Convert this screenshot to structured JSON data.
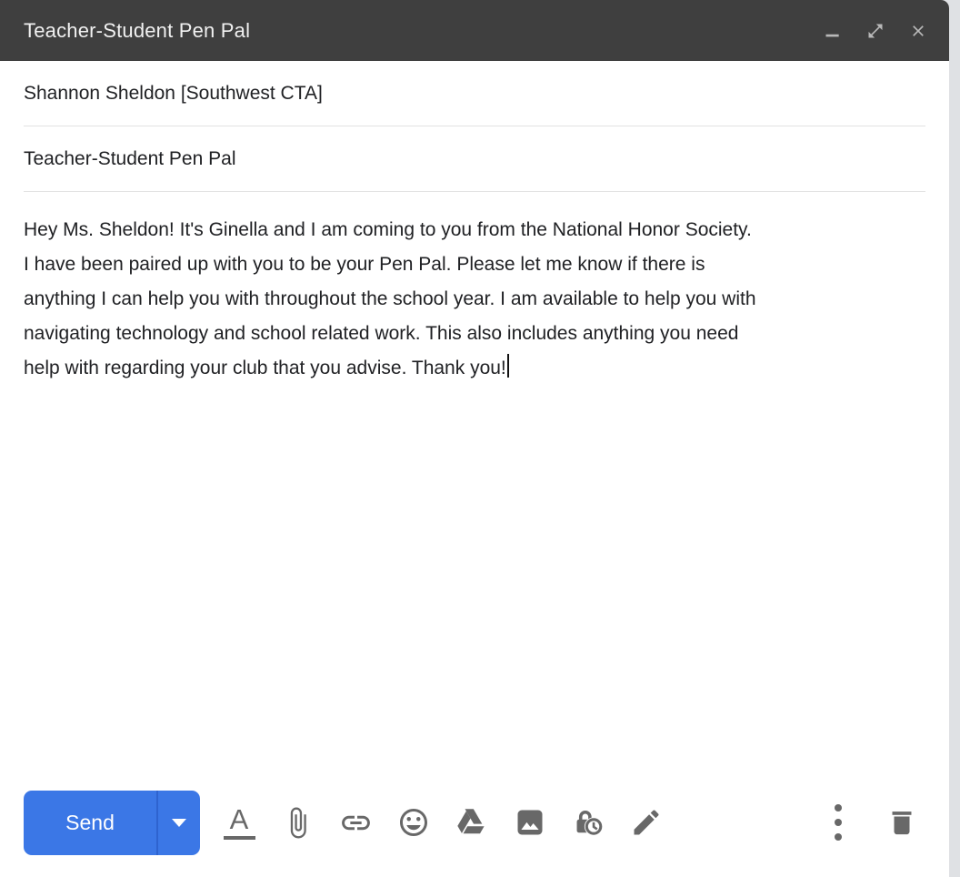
{
  "window": {
    "title": "Teacher-Student Pen Pal",
    "controls": [
      "minimize",
      "pop-out",
      "close"
    ]
  },
  "compose": {
    "recipient": "Shannon Sheldon [Southwest CTA]",
    "subject": "Teacher-Student Pen Pal",
    "body_lines": [
      "Hey Ms. Sheldon! It's Ginella and I am coming to you from the National Honor Society.",
      "I have been paired up with you to be your Pen Pal. Please let me know if there is",
      "anything I can help you with throughout the school year. I am available to help you with",
      "navigating technology and school related work. This also includes anything you need",
      "help with regarding your club that you advise. Thank you!"
    ]
  },
  "toolbar": {
    "send_label": "Send",
    "format_letter": "A",
    "icons": [
      "formatting-options",
      "attach-files",
      "insert-link",
      "insert-emoji",
      "insert-from-drive",
      "insert-photo",
      "confidential-mode",
      "insert-signature"
    ],
    "right_icons": [
      "more-options",
      "discard-draft"
    ]
  },
  "colors": {
    "header_bg": "#3f3f3f",
    "send_button": "#3b77e6",
    "icon_gray": "#686868",
    "text": "#202124",
    "divider": "#e3e3e3",
    "page_strip": "#dfe1e4"
  }
}
